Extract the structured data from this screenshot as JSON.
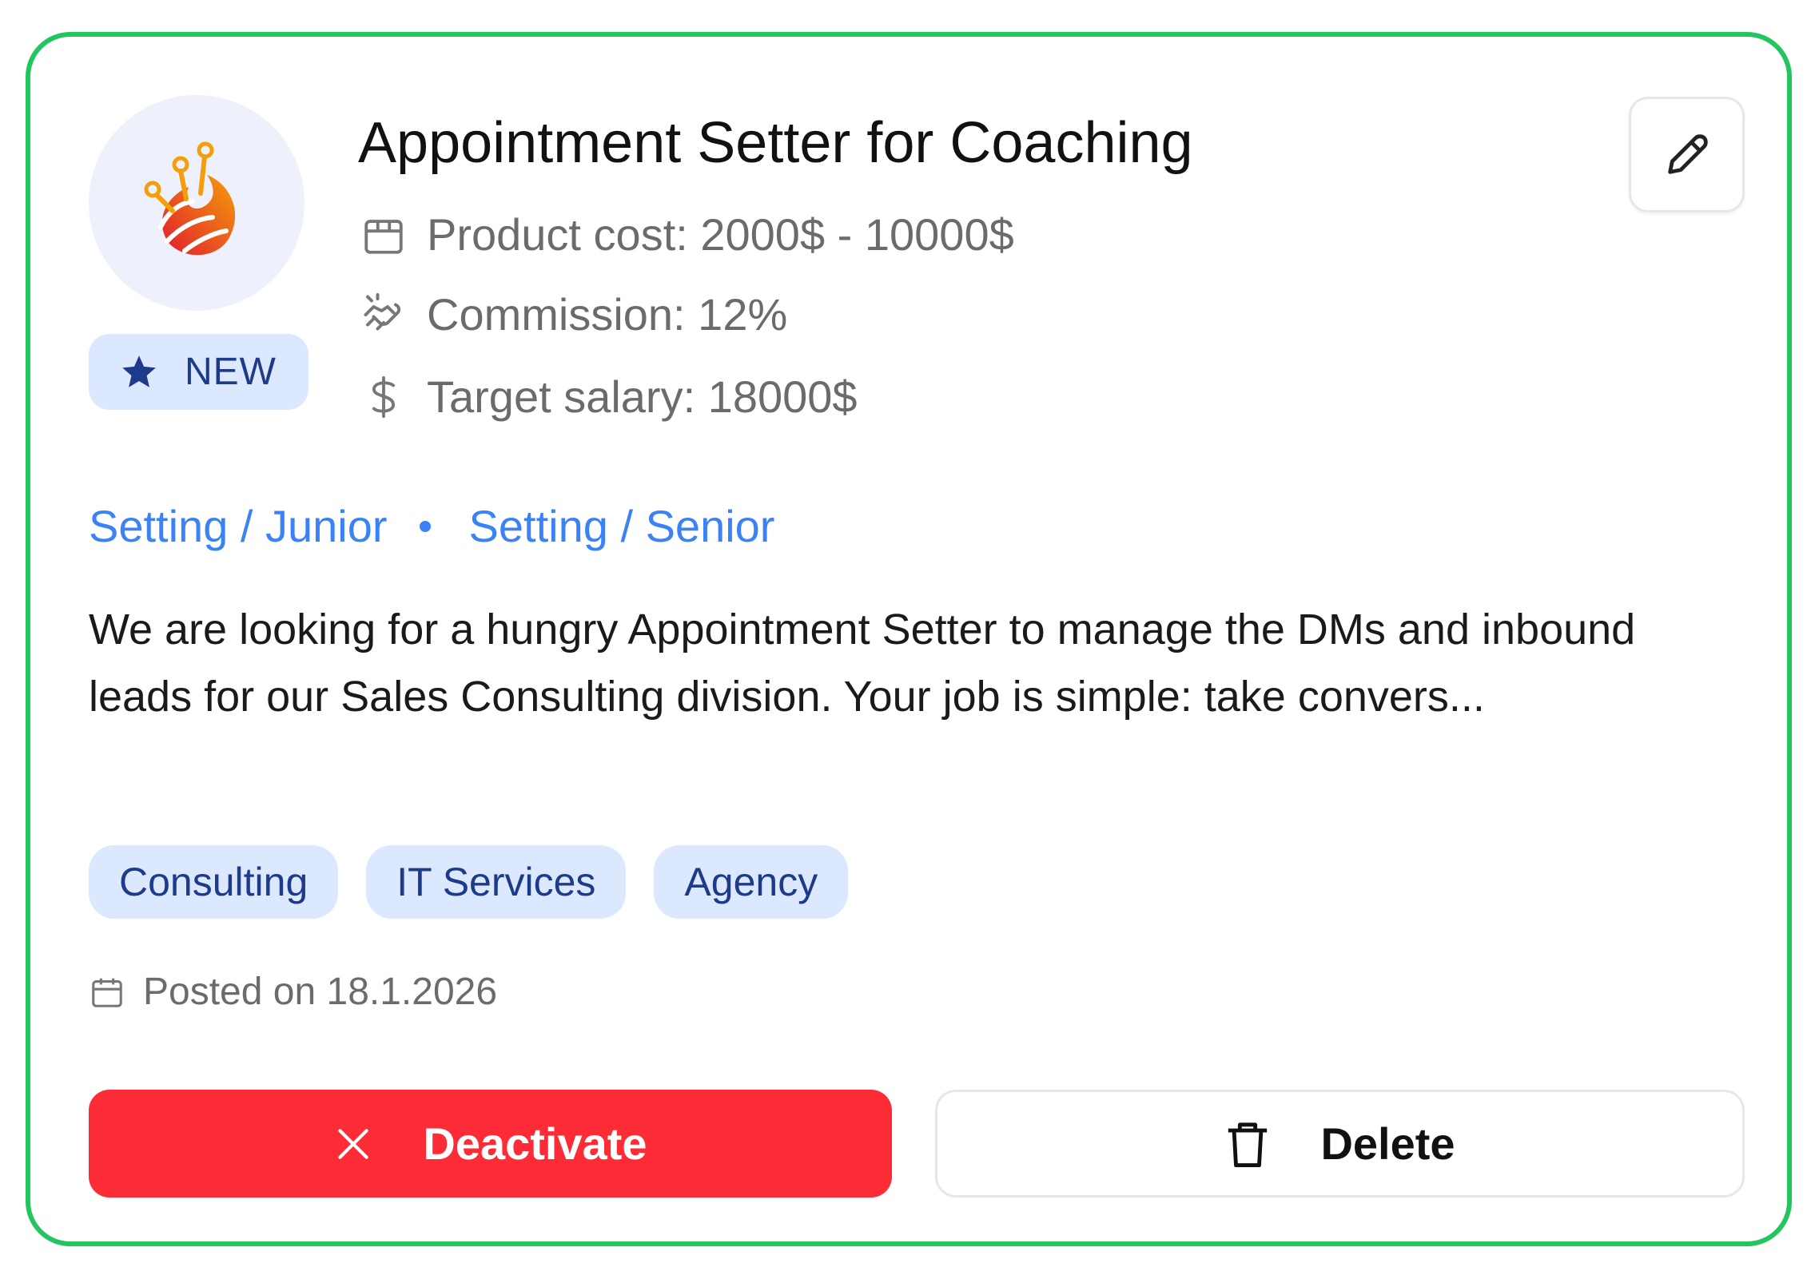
{
  "job": {
    "title": "Appointment Setter for Coaching",
    "badge": "NEW",
    "product_cost": "Product cost: 2000$ - 10000$",
    "commission": "Commission: 12%",
    "target_salary": "Target salary: 18000$",
    "levels": [
      "Setting / Junior",
      "Setting / Senior"
    ],
    "description": "We are looking for a hungry Appointment Setter to manage the DMs and inbound leads for our Sales Consulting division. Your job is simple: take convers...",
    "tags": [
      "Consulting",
      "IT Services",
      "Agency"
    ],
    "posted": "Posted on 18.1.2026"
  },
  "actions": {
    "deactivate_label": "Deactivate",
    "delete_label": "Delete"
  },
  "icons": {
    "logo": "flame-logo",
    "badge": "star-icon",
    "cost": "box-icon",
    "commission": "handshake-icon",
    "salary": "dollar-icon",
    "edit": "pencil-icon",
    "posted": "calendar-icon",
    "deactivate": "close-icon",
    "delete": "trash-icon"
  },
  "colors": {
    "card_border": "#22c55e",
    "accent_blue": "#3b82f6",
    "tag_bg": "#dbe8fd",
    "tag_text": "#1e3a8a",
    "danger": "#fb2c36"
  }
}
